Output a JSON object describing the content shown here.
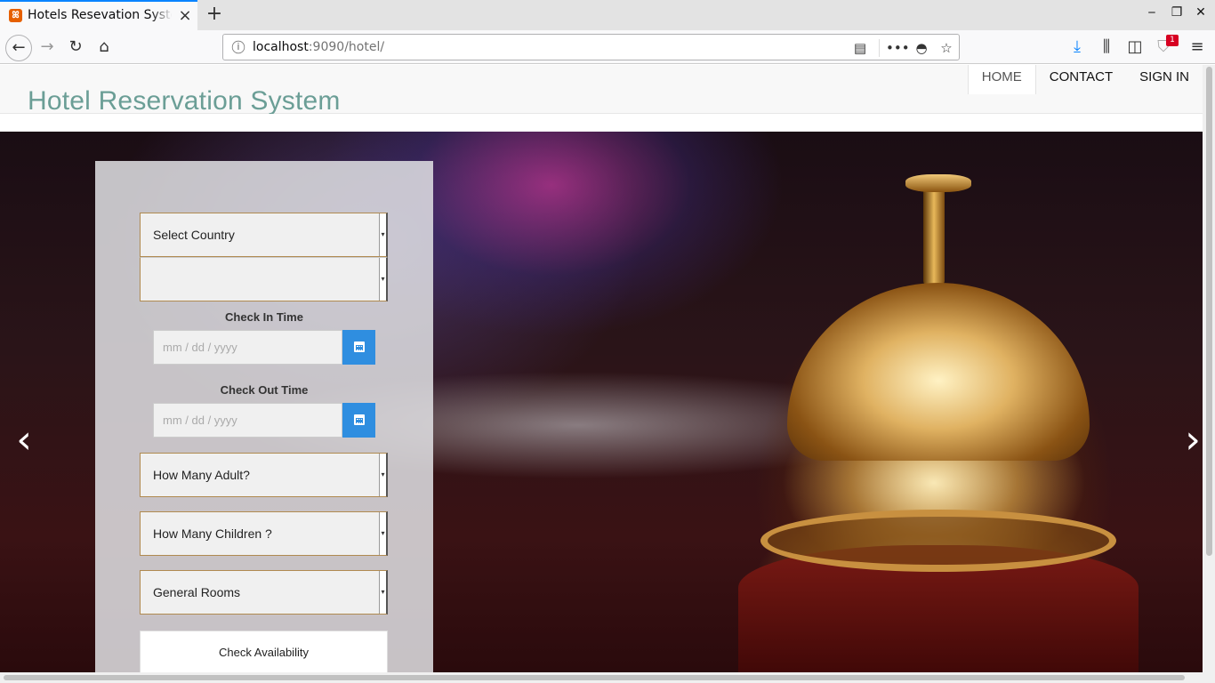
{
  "browser": {
    "tab": {
      "title": "Hotels Resevation System"
    },
    "url": {
      "host": "localhost",
      "rest": ":9090/hotel/"
    },
    "badge_count": "1"
  },
  "site": {
    "title": "Hotel Reservation System",
    "menu": [
      {
        "label": "HOME",
        "active": true
      },
      {
        "label": "CONTACT"
      },
      {
        "label": "SIGN IN"
      }
    ]
  },
  "form": {
    "country_select": "Select Country",
    "city_select": "",
    "check_in_label": "Check In Time",
    "check_in_placeholder": "mm / dd / yyyy",
    "check_out_label": "Check Out Time",
    "check_out_placeholder": "mm / dd / yyyy",
    "adult_select": "How Many Adult?",
    "children_select": "How Many Children ?",
    "room_select": "General Rooms",
    "submit_label": "Check Availability"
  },
  "carousel": {
    "prev_icon": "‹",
    "next_icon": "›"
  },
  "colors": {
    "title": "#6b9e96",
    "accent": "#2f8ee0"
  }
}
